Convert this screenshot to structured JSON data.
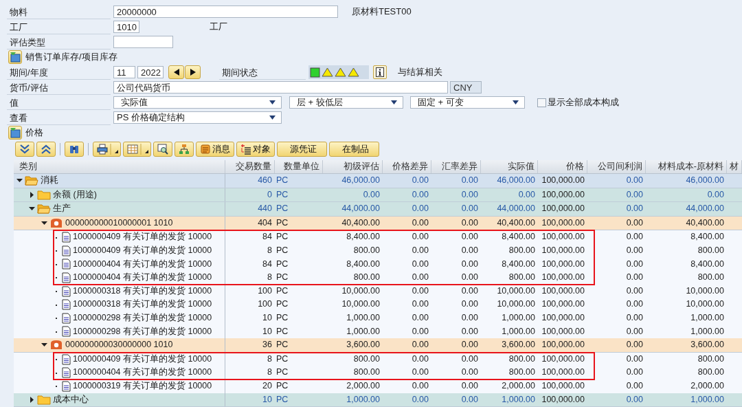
{
  "form": {
    "material": {
      "label": "物料",
      "value": "20000000",
      "description": "原材料TEST00"
    },
    "plant": {
      "label": "工厂",
      "value": "1010",
      "description": "工厂"
    },
    "valuation_type": {
      "label": "评估类型"
    },
    "sales_order_toggle": {
      "label": "销售订单库存/项目库存"
    },
    "period": {
      "label": "期间/年度",
      "period": "11",
      "year": "2022",
      "status_label": "期间状态",
      "status_lamps": [
        {
          "kind": "square",
          "color": "#2fd12f"
        },
        {
          "kind": "triangle",
          "color": "#f5e800"
        },
        {
          "kind": "triangle",
          "color": "#f5e800"
        },
        {
          "kind": "triangle",
          "color": "#f5e800"
        }
      ],
      "info_text": "与结算相关"
    },
    "currency": {
      "label": "货币/评估",
      "value": "公司代码货币",
      "unit": "CNY"
    },
    "values": {
      "label": "值",
      "dropdowns": [
        "实际值",
        "层 + 较低层",
        "固定 + 可变"
      ],
      "checkbox": {
        "label": "显示全部成本构成",
        "checked": false
      }
    },
    "view": {
      "label": "查看",
      "value": "PS 价格确定结构"
    },
    "price_toggle": {
      "label": "价格"
    }
  },
  "toolbar": [
    {
      "kind": "icon"
    },
    {
      "kind": "icon"
    },
    {
      "kind": "separator"
    },
    {
      "kind": "icon"
    },
    {
      "kind": "separator"
    },
    {
      "kind": "menu"
    },
    {
      "kind": "menu"
    },
    {
      "kind": "icon"
    },
    {
      "kind": "icon"
    },
    {
      "kind": "icon-text",
      "label": "消息"
    },
    {
      "kind": "icon-text",
      "label": "对象"
    },
    {
      "kind": "text",
      "label": "源凭证"
    },
    {
      "kind": "text",
      "label": "在制品"
    }
  ],
  "table": {
    "columns": [
      "类别",
      "交易数量",
      "数量单位",
      "初级评估",
      "价格差异",
      "汇率差异",
      "实际值",
      "价格",
      "公司间利润",
      "材料成本-原材料",
      "材"
    ],
    "rows": [
      {
        "kind": "summary",
        "label": "消耗",
        "expanded": true,
        "values": [
          "460",
          "PC",
          "46,000.00",
          "0.00",
          "0.00",
          "46,000.00",
          "100,000.00",
          "0.00",
          "46,000.00"
        ],
        "children": [
          {
            "kind": "folder",
            "label": "余额 (用途)",
            "expanded": false,
            "values": [
              "0",
              "PC",
              "0.00",
              "0.00",
              "0.00",
              "0.00",
              "100,000.00",
              "0.00",
              "0.00"
            ]
          },
          {
            "kind": "folder",
            "label": "生产",
            "expanded": true,
            "values": [
              "440",
              "PC",
              "44,000.00",
              "0.00",
              "0.00",
              "44,000.00",
              "100,000.00",
              "0.00",
              "44,000.00"
            ],
            "children": [
              {
                "kind": "order",
                "label": "000000000010000001 1010",
                "expanded": true,
                "values": [
                  "404",
                  "PC",
                  "40,400.00",
                  "0.00",
                  "0.00",
                  "40,400.00",
                  "100,000.00",
                  "0.00",
                  "40,400.00"
                ],
                "children": [
                  {
                    "kind": "document",
                    "label": "1000000409 有关订单的发货 10000",
                    "highlighted": true,
                    "values": [
                      "84",
                      "PC",
                      "8,400.00",
                      "0.00",
                      "0.00",
                      "8,400.00",
                      "100,000.00",
                      "0.00",
                      "8,400.00"
                    ]
                  },
                  {
                    "kind": "document",
                    "label": "1000000409 有关订单的发货 10000",
                    "highlighted": true,
                    "values": [
                      "8",
                      "PC",
                      "800.00",
                      "0.00",
                      "0.00",
                      "800.00",
                      "100,000.00",
                      "0.00",
                      "800.00"
                    ]
                  },
                  {
                    "kind": "document",
                    "label": "1000000404 有关订单的发货 10000",
                    "highlighted": true,
                    "values": [
                      "84",
                      "PC",
                      "8,400.00",
                      "0.00",
                      "0.00",
                      "8,400.00",
                      "100,000.00",
                      "0.00",
                      "8,400.00"
                    ]
                  },
                  {
                    "kind": "document",
                    "label": "1000000404 有关订单的发货 10000",
                    "highlighted": true,
                    "values": [
                      "8",
                      "PC",
                      "800.00",
                      "0.00",
                      "0.00",
                      "800.00",
                      "100,000.00",
                      "0.00",
                      "800.00"
                    ]
                  },
                  {
                    "kind": "document",
                    "label": "1000000318 有关订单的发货 10000",
                    "highlighted": false,
                    "values": [
                      "100",
                      "PC",
                      "10,000.00",
                      "0.00",
                      "0.00",
                      "10,000.00",
                      "100,000.00",
                      "0.00",
                      "10,000.00"
                    ]
                  },
                  {
                    "kind": "document",
                    "label": "1000000318 有关订单的发货 10000",
                    "highlighted": false,
                    "values": [
                      "100",
                      "PC",
                      "10,000.00",
                      "0.00",
                      "0.00",
                      "10,000.00",
                      "100,000.00",
                      "0.00",
                      "10,000.00"
                    ]
                  },
                  {
                    "kind": "document",
                    "label": "1000000298 有关订单的发货 10000",
                    "highlighted": false,
                    "values": [
                      "10",
                      "PC",
                      "1,000.00",
                      "0.00",
                      "0.00",
                      "1,000.00",
                      "100,000.00",
                      "0.00",
                      "1,000.00"
                    ]
                  },
                  {
                    "kind": "document",
                    "label": "1000000298 有关订单的发货 10000",
                    "highlighted": false,
                    "values": [
                      "10",
                      "PC",
                      "1,000.00",
                      "0.00",
                      "0.00",
                      "1,000.00",
                      "100,000.00",
                      "0.00",
                      "1,000.00"
                    ]
                  }
                ]
              },
              {
                "kind": "order",
                "label": "000000000030000000 1010",
                "expanded": true,
                "values": [
                  "36",
                  "PC",
                  "3,600.00",
                  "0.00",
                  "0.00",
                  "3,600.00",
                  "100,000.00",
                  "0.00",
                  "3,600.00"
                ],
                "children": [
                  {
                    "kind": "document",
                    "label": "1000000409 有关订单的发货 10000",
                    "highlighted": true,
                    "values": [
                      "8",
                      "PC",
                      "800.00",
                      "0.00",
                      "0.00",
                      "800.00",
                      "100,000.00",
                      "0.00",
                      "800.00"
                    ]
                  },
                  {
                    "kind": "document",
                    "label": "1000000404 有关订单的发货 10000",
                    "highlighted": true,
                    "values": [
                      "8",
                      "PC",
                      "800.00",
                      "0.00",
                      "0.00",
                      "800.00",
                      "100,000.00",
                      "0.00",
                      "800.00"
                    ]
                  },
                  {
                    "kind": "document",
                    "label": "1000000319 有关订单的发货 10000",
                    "highlighted": false,
                    "values": [
                      "20",
                      "PC",
                      "2,000.00",
                      "0.00",
                      "0.00",
                      "2,000.00",
                      "100,000.00",
                      "0.00",
                      "2,000.00"
                    ]
                  }
                ]
              }
            ]
          },
          {
            "kind": "folder",
            "label": "成本中心",
            "expanded": false,
            "values": [
              "10",
              "PC",
              "1,000.00",
              "0.00",
              "0.00",
              "1,000.00",
              "100,000.00",
              "0.00",
              "1,000.00"
            ]
          }
        ]
      }
    ]
  }
}
